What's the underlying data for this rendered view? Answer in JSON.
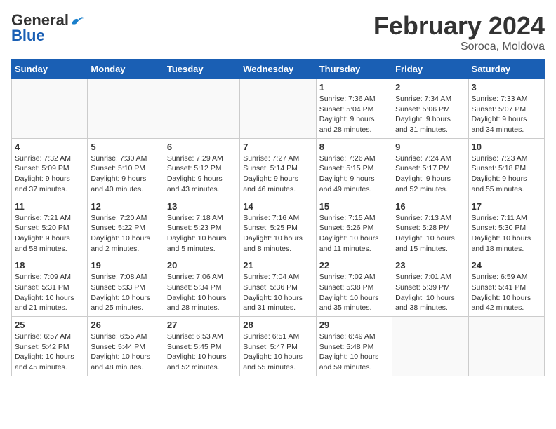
{
  "header": {
    "logo_line1": "General",
    "logo_line2": "Blue",
    "month": "February 2024",
    "location": "Soroca, Moldova"
  },
  "days_of_week": [
    "Sunday",
    "Monday",
    "Tuesday",
    "Wednesday",
    "Thursday",
    "Friday",
    "Saturday"
  ],
  "weeks": [
    [
      {
        "day": "",
        "info": ""
      },
      {
        "day": "",
        "info": ""
      },
      {
        "day": "",
        "info": ""
      },
      {
        "day": "",
        "info": ""
      },
      {
        "day": "1",
        "info": "Sunrise: 7:36 AM\nSunset: 5:04 PM\nDaylight: 9 hours\nand 28 minutes."
      },
      {
        "day": "2",
        "info": "Sunrise: 7:34 AM\nSunset: 5:06 PM\nDaylight: 9 hours\nand 31 minutes."
      },
      {
        "day": "3",
        "info": "Sunrise: 7:33 AM\nSunset: 5:07 PM\nDaylight: 9 hours\nand 34 minutes."
      }
    ],
    [
      {
        "day": "4",
        "info": "Sunrise: 7:32 AM\nSunset: 5:09 PM\nDaylight: 9 hours\nand 37 minutes."
      },
      {
        "day": "5",
        "info": "Sunrise: 7:30 AM\nSunset: 5:10 PM\nDaylight: 9 hours\nand 40 minutes."
      },
      {
        "day": "6",
        "info": "Sunrise: 7:29 AM\nSunset: 5:12 PM\nDaylight: 9 hours\nand 43 minutes."
      },
      {
        "day": "7",
        "info": "Sunrise: 7:27 AM\nSunset: 5:14 PM\nDaylight: 9 hours\nand 46 minutes."
      },
      {
        "day": "8",
        "info": "Sunrise: 7:26 AM\nSunset: 5:15 PM\nDaylight: 9 hours\nand 49 minutes."
      },
      {
        "day": "9",
        "info": "Sunrise: 7:24 AM\nSunset: 5:17 PM\nDaylight: 9 hours\nand 52 minutes."
      },
      {
        "day": "10",
        "info": "Sunrise: 7:23 AM\nSunset: 5:18 PM\nDaylight: 9 hours\nand 55 minutes."
      }
    ],
    [
      {
        "day": "11",
        "info": "Sunrise: 7:21 AM\nSunset: 5:20 PM\nDaylight: 9 hours\nand 58 minutes."
      },
      {
        "day": "12",
        "info": "Sunrise: 7:20 AM\nSunset: 5:22 PM\nDaylight: 10 hours\nand 2 minutes."
      },
      {
        "day": "13",
        "info": "Sunrise: 7:18 AM\nSunset: 5:23 PM\nDaylight: 10 hours\nand 5 minutes."
      },
      {
        "day": "14",
        "info": "Sunrise: 7:16 AM\nSunset: 5:25 PM\nDaylight: 10 hours\nand 8 minutes."
      },
      {
        "day": "15",
        "info": "Sunrise: 7:15 AM\nSunset: 5:26 PM\nDaylight: 10 hours\nand 11 minutes."
      },
      {
        "day": "16",
        "info": "Sunrise: 7:13 AM\nSunset: 5:28 PM\nDaylight: 10 hours\nand 15 minutes."
      },
      {
        "day": "17",
        "info": "Sunrise: 7:11 AM\nSunset: 5:30 PM\nDaylight: 10 hours\nand 18 minutes."
      }
    ],
    [
      {
        "day": "18",
        "info": "Sunrise: 7:09 AM\nSunset: 5:31 PM\nDaylight: 10 hours\nand 21 minutes."
      },
      {
        "day": "19",
        "info": "Sunrise: 7:08 AM\nSunset: 5:33 PM\nDaylight: 10 hours\nand 25 minutes."
      },
      {
        "day": "20",
        "info": "Sunrise: 7:06 AM\nSunset: 5:34 PM\nDaylight: 10 hours\nand 28 minutes."
      },
      {
        "day": "21",
        "info": "Sunrise: 7:04 AM\nSunset: 5:36 PM\nDaylight: 10 hours\nand 31 minutes."
      },
      {
        "day": "22",
        "info": "Sunrise: 7:02 AM\nSunset: 5:38 PM\nDaylight: 10 hours\nand 35 minutes."
      },
      {
        "day": "23",
        "info": "Sunrise: 7:01 AM\nSunset: 5:39 PM\nDaylight: 10 hours\nand 38 minutes."
      },
      {
        "day": "24",
        "info": "Sunrise: 6:59 AM\nSunset: 5:41 PM\nDaylight: 10 hours\nand 42 minutes."
      }
    ],
    [
      {
        "day": "25",
        "info": "Sunrise: 6:57 AM\nSunset: 5:42 PM\nDaylight: 10 hours\nand 45 minutes."
      },
      {
        "day": "26",
        "info": "Sunrise: 6:55 AM\nSunset: 5:44 PM\nDaylight: 10 hours\nand 48 minutes."
      },
      {
        "day": "27",
        "info": "Sunrise: 6:53 AM\nSunset: 5:45 PM\nDaylight: 10 hours\nand 52 minutes."
      },
      {
        "day": "28",
        "info": "Sunrise: 6:51 AM\nSunset: 5:47 PM\nDaylight: 10 hours\nand 55 minutes."
      },
      {
        "day": "29",
        "info": "Sunrise: 6:49 AM\nSunset: 5:48 PM\nDaylight: 10 hours\nand 59 minutes."
      },
      {
        "day": "",
        "info": ""
      },
      {
        "day": "",
        "info": ""
      }
    ]
  ]
}
